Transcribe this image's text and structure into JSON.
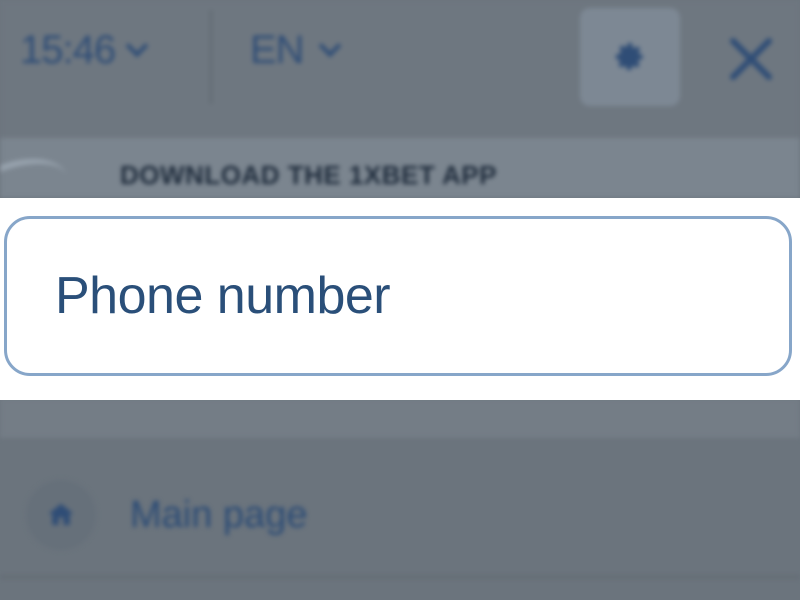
{
  "header": {
    "time": "15:46",
    "language": "EN",
    "settings_icon": "gear-icon",
    "close_icon": "close-icon"
  },
  "banner": {
    "download_text": "DOWNLOAD THE 1XBET APP"
  },
  "form": {
    "phone_placeholder": "Phone number"
  },
  "menu": {
    "items": [
      {
        "label": "Main page",
        "icon": "home-icon"
      }
    ]
  },
  "colors": {
    "accent_blue": "#2f4d76",
    "field_border": "#87a6c9",
    "overlay": "#6e7780"
  }
}
